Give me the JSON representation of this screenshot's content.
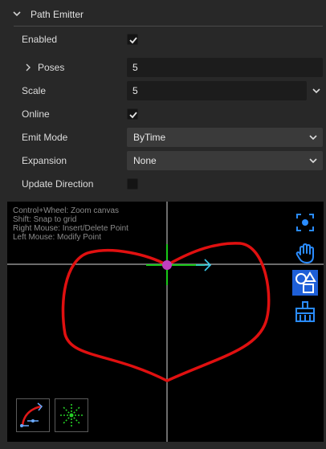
{
  "section": {
    "title": "Path Emitter"
  },
  "fields": {
    "enabled": {
      "label": "Enabled",
      "checked": true
    },
    "poses": {
      "label": "Poses",
      "value": "5"
    },
    "scale": {
      "label": "Scale",
      "value": "5"
    },
    "online": {
      "label": "Online",
      "checked": true
    },
    "emit_mode": {
      "label": "Emit Mode",
      "value": "ByTime"
    },
    "expansion": {
      "label": "Expansion",
      "value": "None"
    },
    "update_direction": {
      "label": "Update Direction",
      "checked": false
    }
  },
  "canvas": {
    "help": [
      "Control+Wheel: Zoom canvas",
      "Shift: Snap to grid",
      "Right Mouse: Insert/Delete Point",
      "Left Mouse: Modify Point"
    ],
    "tools": [
      {
        "name": "focus-icon"
      },
      {
        "name": "hand-icon"
      },
      {
        "name": "shapes-icon"
      },
      {
        "name": "broom-icon"
      }
    ],
    "bottom_tools": [
      {
        "name": "curve-path-icon"
      },
      {
        "name": "radial-burst-icon"
      }
    ],
    "colors": {
      "path": "#e01010",
      "accent": "#2a8cff",
      "handle": "#d040d0"
    }
  }
}
